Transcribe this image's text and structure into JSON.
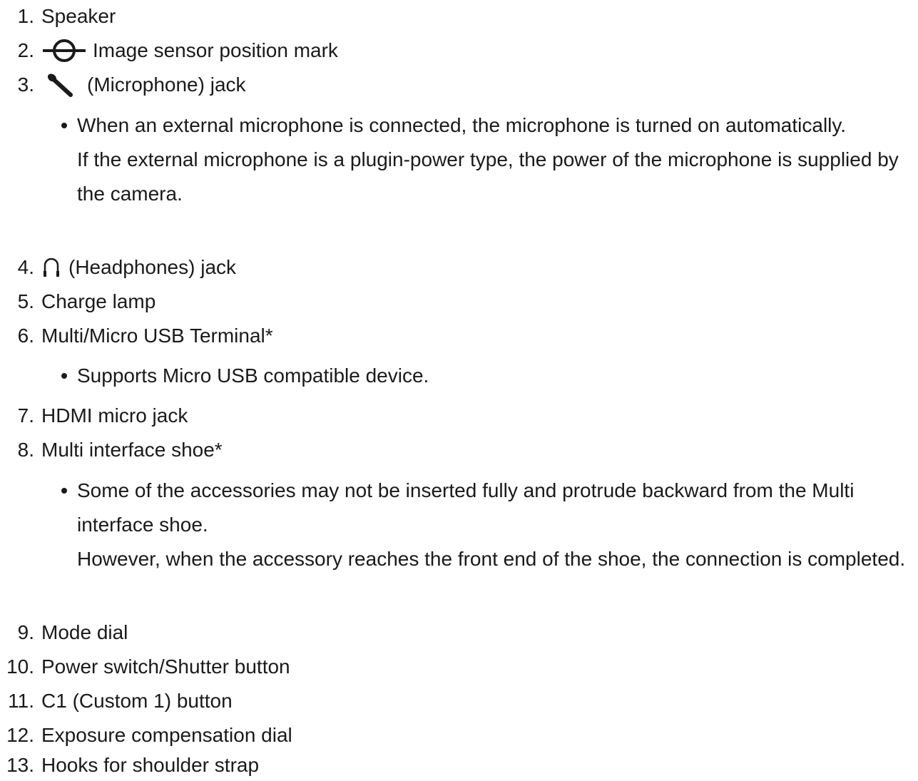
{
  "items": [
    {
      "number": "1.",
      "label": "Speaker"
    },
    {
      "number": "2.",
      "icon": "image-sensor-mark-icon",
      "label": "Image sensor position mark"
    },
    {
      "number": "3.",
      "icon": "microphone-icon",
      "label": "(Microphone) jack",
      "notes": [
        {
          "lines": [
            "When an external microphone is connected, the microphone is turned on automatically.",
            "If the external microphone is a plugin-power type, the power of the microphone is supplied by the camera."
          ]
        }
      ]
    },
    {
      "number": "4.",
      "icon": "headphones-icon",
      "label": "(Headphones) jack"
    },
    {
      "number": "5.",
      "label": "Charge lamp"
    },
    {
      "number": "6.",
      "label": "Multi/Micro USB Terminal*",
      "notes": [
        {
          "lines": [
            "Supports Micro USB compatible device."
          ]
        }
      ]
    },
    {
      "number": "7.",
      "label": "HDMI micro jack"
    },
    {
      "number": "8.",
      "label": "Multi interface shoe*",
      "notes": [
        {
          "lines": [
            "Some of the accessories may not be inserted fully and protrude backward from the Multi interface shoe.",
            "However, when the accessory reaches the front end of the shoe, the connection is completed."
          ]
        }
      ]
    },
    {
      "number": "9.",
      "label": "Mode dial"
    },
    {
      "number": "10.",
      "label": "Power switch/Shutter button"
    },
    {
      "number": "11.",
      "label": "C1 (Custom 1) button"
    },
    {
      "number": "12.",
      "label": "Exposure compensation dial"
    },
    {
      "number": "13.",
      "label": "Hooks for shoulder strap"
    }
  ]
}
